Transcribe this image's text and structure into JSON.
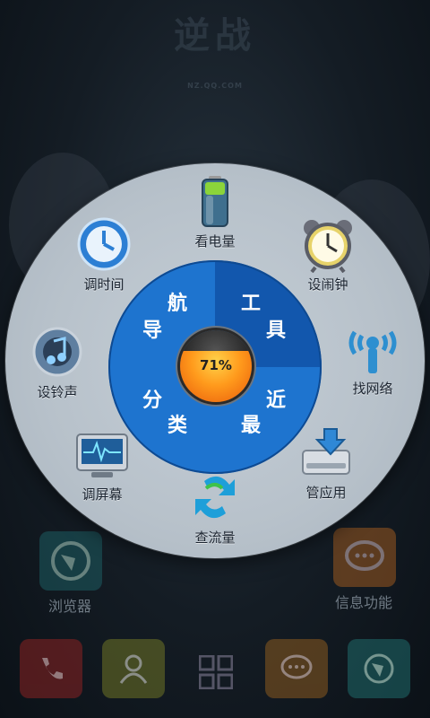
{
  "wallpaper": {
    "logo_text": "逆战",
    "logo_sub": "NZ.QQ.COM"
  },
  "menu": {
    "items": [
      {
        "label": "看电量",
        "icon": "battery-icon"
      },
      {
        "label": "设闹钟",
        "icon": "alarm-clock-icon"
      },
      {
        "label": "找网络",
        "icon": "wifi-antenna-icon"
      },
      {
        "label": "管应用",
        "icon": "app-manager-icon"
      },
      {
        "label": "查流量",
        "icon": "data-traffic-icon"
      },
      {
        "label": "调屏幕",
        "icon": "screen-settings-icon"
      },
      {
        "label": "设铃声",
        "icon": "ringtone-icon"
      },
      {
        "label": "调时间",
        "icon": "time-icon"
      }
    ],
    "inner": {
      "segments": [
        {
          "chars": [
            "航",
            "导"
          ]
        },
        {
          "chars": [
            "工",
            "具"
          ]
        },
        {
          "chars": [
            "近",
            "最"
          ]
        },
        {
          "chars": [
            "分",
            "类"
          ]
        }
      ],
      "percent_text": "71%",
      "percent": 71
    }
  },
  "desktop": {
    "left_app_label": "浏览器",
    "right_app_label": "信息功能"
  },
  "dock": {
    "apps": [
      "phone-icon",
      "contacts-icon",
      "app-drawer-icon",
      "messages-icon",
      "browser-icon"
    ]
  }
}
